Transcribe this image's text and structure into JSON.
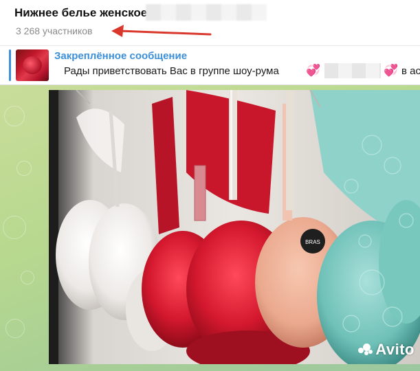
{
  "header": {
    "title": "Нижнее белье женское",
    "members": "3 268 участников",
    "arrow_color": "#d9372b"
  },
  "pinned": {
    "title": "Закреплённое сообщение",
    "text": "Рады приветствовать Вас в группе шоу-рума",
    "heart_glyph": "💞",
    "tail": "в ас",
    "accent_color": "#3a8fd8"
  },
  "photo": {
    "watermark": "Avito",
    "tag_text": "BRAS"
  }
}
